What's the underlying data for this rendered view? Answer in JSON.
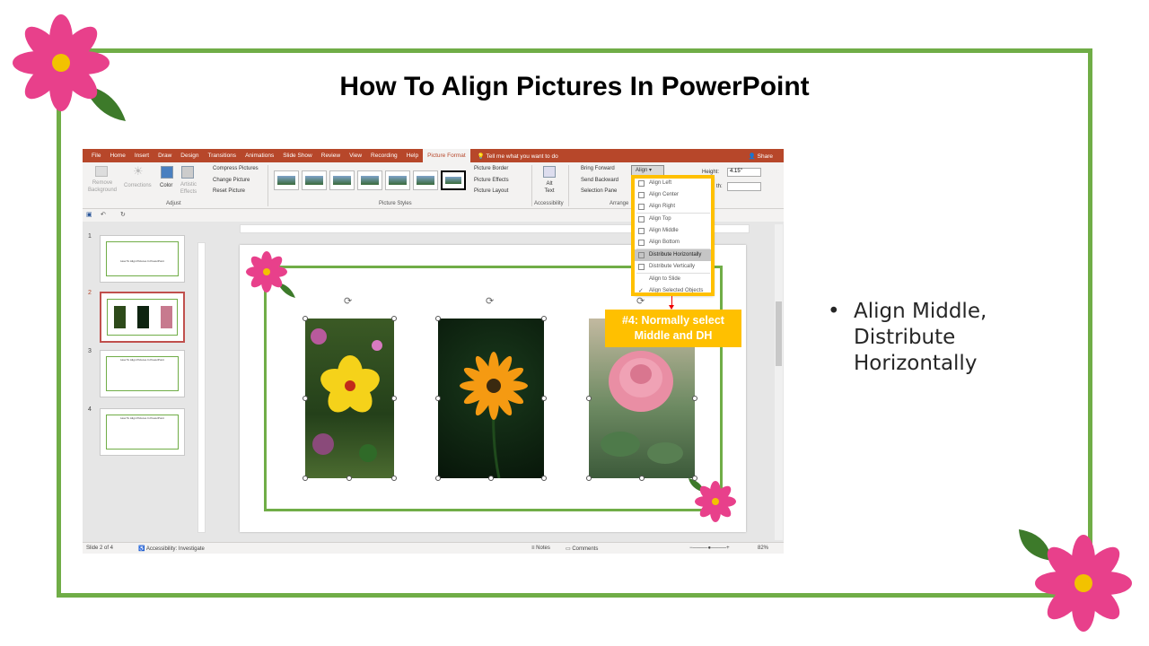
{
  "slide": {
    "title": "How To Align Pictures In PowerPoint",
    "bullet": "Align Middle, Distribute Horizontally",
    "bullet_marker": "•",
    "frame_color": "#70AD47"
  },
  "ppt": {
    "tabs": [
      "File",
      "Home",
      "Insert",
      "Draw",
      "Design",
      "Transitions",
      "Animations",
      "Slide Show",
      "Review",
      "View",
      "Recording",
      "Help",
      "Picture Format"
    ],
    "active_tab": "Picture Format",
    "tell_me": "Tell me what you want to do",
    "share": "Share",
    "ribbon": {
      "remove_background": "Remove Background",
      "corrections": "Corrections",
      "color": "Color",
      "artistic_effects": "Artistic Effects",
      "compress_pictures": "Compress Pictures",
      "change_picture": "Change Picture",
      "reset_picture": "Reset Picture",
      "adjust_label": "Adjust",
      "picture_styles_label": "Picture Styles",
      "picture_border": "Picture Border",
      "picture_effects": "Picture Effects",
      "picture_layout": "Picture Layout",
      "alt_text": "Alt Text",
      "accessibility_label": "Accessibility",
      "bring_forward": "Bring Forward",
      "send_backward": "Send Backward",
      "selection_pane": "Selection Pane",
      "arrange_label": "Arrange",
      "align": "Align",
      "height_label": "Height:",
      "height_value": "4.15\"",
      "width_label": "th:"
    },
    "align_menu": [
      "Align Left",
      "Align Center",
      "Align Right",
      "Align Top",
      "Align Middle",
      "Align Bottom",
      "Distribute Horizontally",
      "Distribute Vertically",
      "Align to Slide",
      "Align Selected Objects"
    ],
    "highlighted_item": "Distribute Horizontally",
    "thumbnails": [
      {
        "num": "1",
        "title": "How To Align Pictures In PowerPoint"
      },
      {
        "num": "2",
        "title": ""
      },
      {
        "num": "3",
        "title": "How To Align Pictures In PowerPoint"
      },
      {
        "num": "4",
        "title": "How To Align Pictures In PowerPoint"
      }
    ],
    "status": {
      "slide_of": "Slide 2 of 4",
      "accessibility": "Accessibility: Investigate",
      "notes": "Notes",
      "comments": "Comments",
      "zoom": "82%"
    }
  },
  "callout": {
    "line1": "#4: Normally select",
    "line2": "Middle and DH",
    "color": "#FFC000"
  }
}
